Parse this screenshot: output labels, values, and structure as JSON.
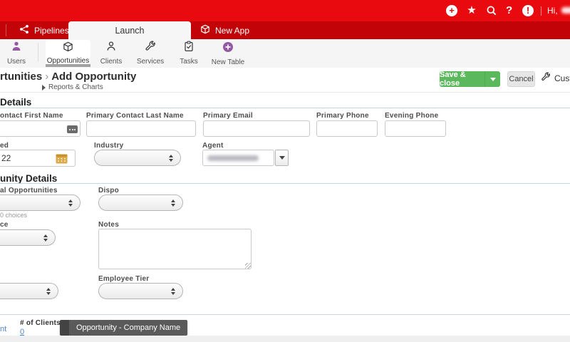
{
  "topbar": {
    "greeting": "Hi,",
    "plus": "+",
    "question": "?",
    "exclamation": "!",
    "star": "★"
  },
  "tabs": {
    "pipelines": "Pipelines",
    "launch": "Launch",
    "new_app": "New App"
  },
  "toolbar": {
    "items": [
      {
        "label": "Users"
      },
      {
        "label": "Opportunities"
      },
      {
        "label": "Clients"
      },
      {
        "label": "Services"
      },
      {
        "label": "Tasks"
      },
      {
        "label": "New Table"
      }
    ]
  },
  "header": {
    "breadcrumb": {
      "parent": "rtunities",
      "separator": "›",
      "title": "Add Opportunity"
    },
    "reports_toggle": "Reports & Charts",
    "save_label": "Save & close",
    "cancel_label": "Cancel",
    "customize_label": "Custo"
  },
  "form": {
    "contact_section": {
      "title": "Details",
      "first_name_label": "ontact First Name",
      "last_name_label": "Primary Contact Last Name",
      "email_label": "Primary Email",
      "primary_phone_label": "Primary Phone",
      "evening_phone_label": "Evening Phone",
      "date_label": "ed",
      "date_value": "22",
      "industry_label": "Industry",
      "agent_label": "Agent"
    },
    "opportunity_section": {
      "title": "unity Details",
      "additional_label": "al Opportunities",
      "additional_hint": "0 choices",
      "dispo_label": "Dispo",
      "source_label": "ce",
      "notes_label": "Notes",
      "tier_label": "Employee Tier"
    }
  },
  "footer": {
    "link_fragment": "nt",
    "clients_label": "# of Clients",
    "clients_value": "0",
    "drag_tooltip": "Opportunity - Company Name"
  },
  "colors": {
    "topbar_red": "#e90a0f",
    "tabbar_red": "#c20409",
    "save_green": "#5cb85c",
    "brand_purple": "#9457a3",
    "link_blue": "#4f86c6",
    "tooltip_gray": "#5a5a5a"
  }
}
